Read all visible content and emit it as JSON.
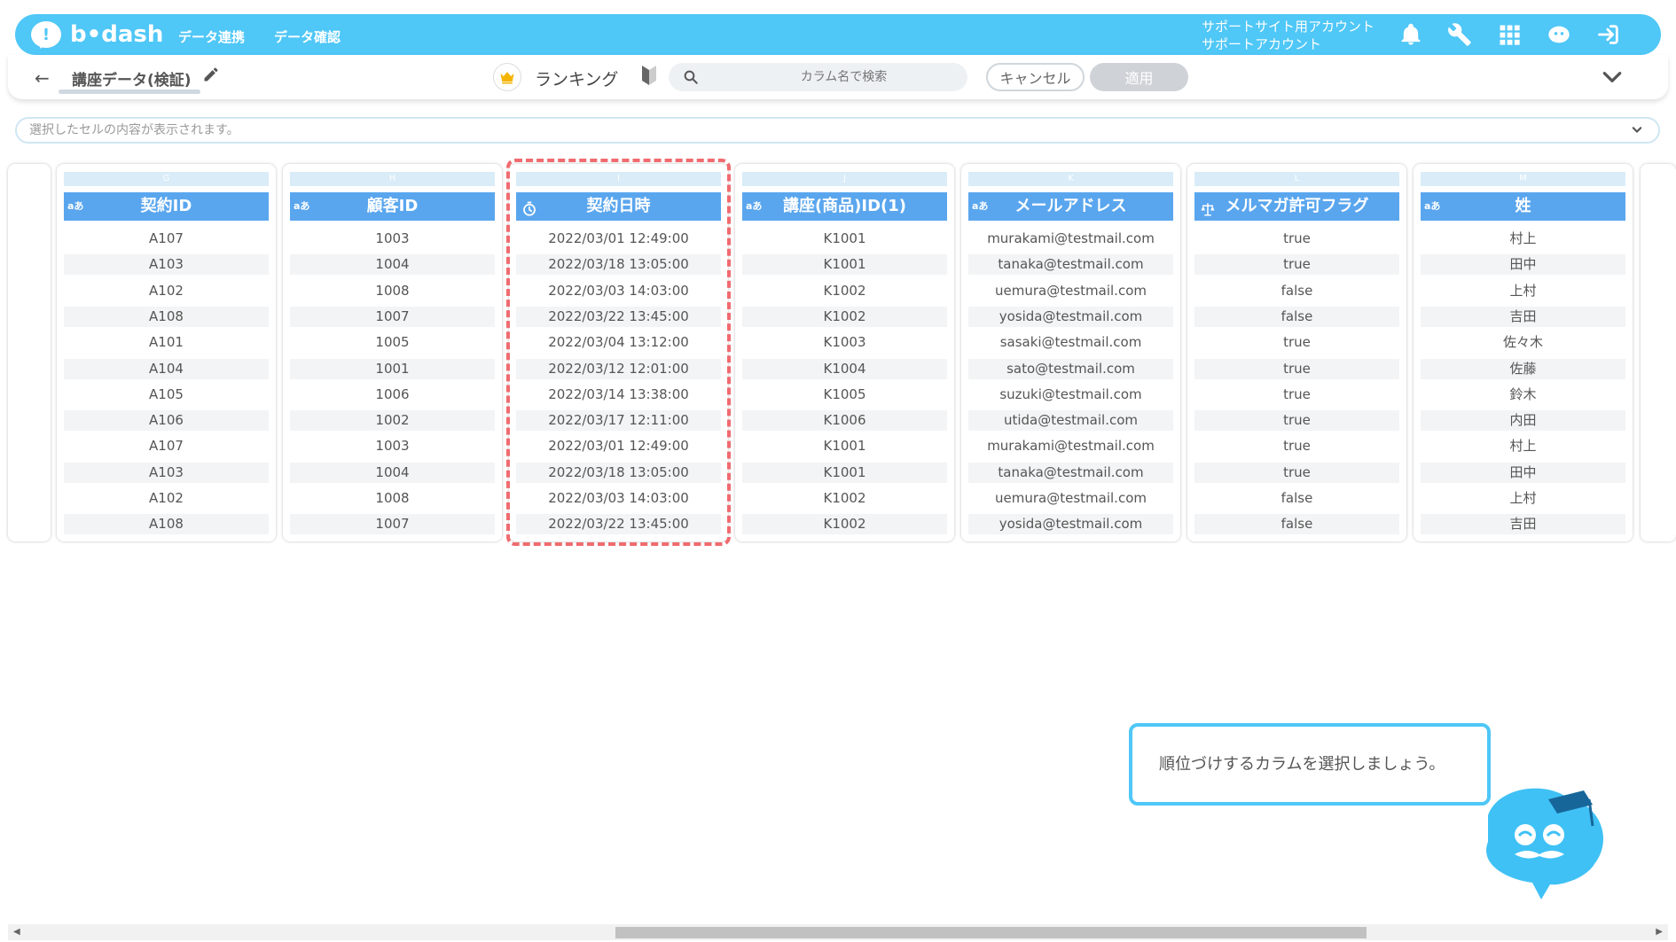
{
  "header": {
    "logo_text": "b•dash",
    "nav": [
      "データ連携",
      "データ確認"
    ],
    "account_line1": "サポートサイト用アカウント",
    "account_line2": "サポートアカウント",
    "icons": [
      "bell-icon",
      "wrench-icon",
      "grid-icon",
      "chat-bot-icon",
      "logout-icon"
    ]
  },
  "toolbar": {
    "title": "講座データ(検証)",
    "ranking_label": "ランキング",
    "search_placeholder": "カラム名で検索",
    "cancel_label": "キャンセル",
    "apply_label": "適用"
  },
  "cell_display": {
    "placeholder": "選択したセルの内容が表示されます。"
  },
  "table": {
    "columns": [
      {
        "letter": "G",
        "type": "aあ",
        "name": "契約ID",
        "values": [
          "A107",
          "A103",
          "A102",
          "A108",
          "A101",
          "A104",
          "A105",
          "A106",
          "A107",
          "A103",
          "A102",
          "A108"
        ]
      },
      {
        "letter": "H",
        "type": "aあ",
        "name": "顧客ID",
        "values": [
          "1003",
          "1004",
          "1008",
          "1007",
          "1005",
          "1001",
          "1006",
          "1002",
          "1003",
          "1004",
          "1008",
          "1007"
        ]
      },
      {
        "letter": "I",
        "type": "datetime",
        "name": "契約日時",
        "values": [
          "2022/03/01 12:49:00",
          "2022/03/18 13:05:00",
          "2022/03/03 14:03:00",
          "2022/03/22 13:45:00",
          "2022/03/04 13:12:00",
          "2022/03/12 12:01:00",
          "2022/03/14 13:38:00",
          "2022/03/17 12:11:00",
          "2022/03/01 12:49:00",
          "2022/03/18 13:05:00",
          "2022/03/03 14:03:00",
          "2022/03/22 13:45:00"
        ]
      },
      {
        "letter": "J",
        "type": "aあ",
        "name": "講座(商品)ID(1)",
        "values": [
          "K1001",
          "K1001",
          "K1002",
          "K1002",
          "K1003",
          "K1004",
          "K1005",
          "K1006",
          "K1001",
          "K1001",
          "K1002",
          "K1002"
        ]
      },
      {
        "letter": "K",
        "type": "aあ",
        "name": "メールアドレス",
        "values": [
          "murakami@testmail.com",
          "tanaka@testmail.com",
          "uemura@testmail.com",
          "yosida@testmail.com",
          "sasaki@testmail.com",
          "sato@testmail.com",
          "suzuki@testmail.com",
          "utida@testmail.com",
          "murakami@testmail.com",
          "tanaka@testmail.com",
          "uemura@testmail.com",
          "yosida@testmail.com"
        ]
      },
      {
        "letter": "L",
        "type": "boolean",
        "name": "メルマガ許可フラグ",
        "values": [
          "true",
          "true",
          "false",
          "false",
          "true",
          "true",
          "true",
          "true",
          "true",
          "true",
          "false",
          "false"
        ]
      },
      {
        "letter": "M",
        "type": "aあ",
        "name": "姓",
        "values": [
          "村上",
          "田中",
          "上村",
          "吉田",
          "佐々木",
          "佐藤",
          "鈴木",
          "内田",
          "村上",
          "田中",
          "上村",
          "吉田"
        ]
      }
    ]
  },
  "tooltip": {
    "text": "順位づけするカラムを選択しましょう。"
  },
  "colors": {
    "header": "#4fc7f7",
    "column_header": "#5aa6ee",
    "highlight": "#f06b6f"
  }
}
